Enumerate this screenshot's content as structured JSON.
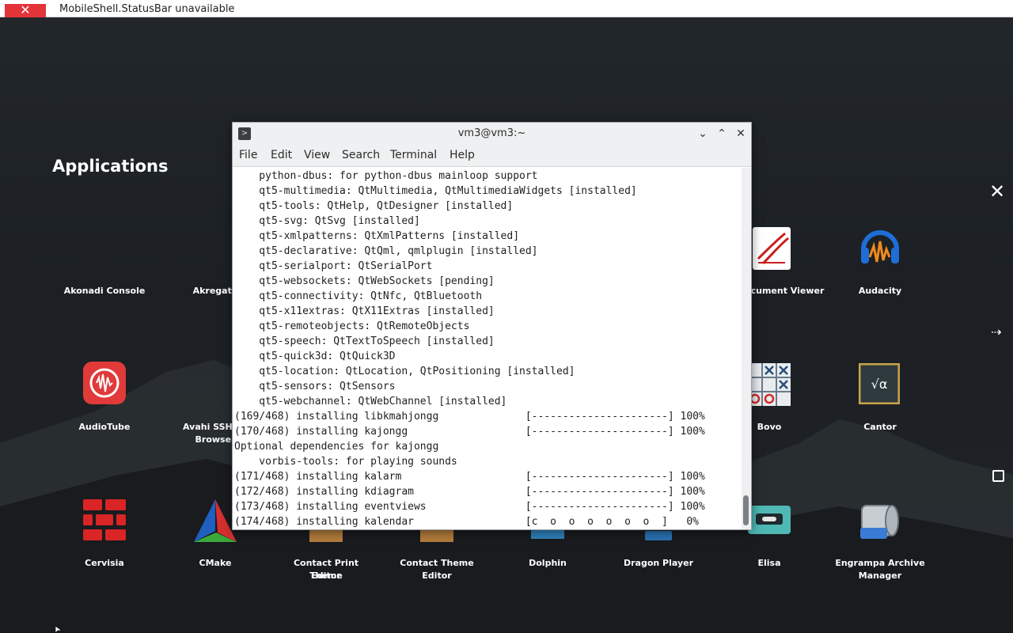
{
  "statusbar": {
    "close_glyph": "✕",
    "text": "MobileShell.StatusBar unavailable"
  },
  "launcher": {
    "title": "Applications",
    "close_glyph": "✕",
    "side_arrow_glyph": "⇢",
    "apps": [
      {
        "label": "Akonadi Console",
        "icon": "akonadi-console-icon"
      },
      {
        "label": "Akregato",
        "icon": "akregator-icon"
      },
      {
        "label": "cument Viewer",
        "icon": "document-viewer-icon"
      },
      {
        "label": "Audacity",
        "icon": "audacity-icon"
      },
      {
        "label": "AudioTube",
        "icon": "audiotube-icon"
      },
      {
        "label": "Avahi SSH Se",
        "label2": "Browser",
        "icon": "avahi-ssh-icon"
      },
      {
        "label": "Bovo",
        "icon": "bovo-icon"
      },
      {
        "label": "Cantor",
        "icon": "cantor-icon"
      },
      {
        "label": "Cervisia",
        "icon": "cervisia-icon"
      },
      {
        "label": "CMake",
        "icon": "cmake-icon"
      },
      {
        "label": "Contact Print Theme",
        "label2": "Editor",
        "icon": "contact-print-theme-icon"
      },
      {
        "label": "Contact Theme Editor",
        "icon": "contact-theme-editor-icon"
      },
      {
        "label": "Dolphin",
        "icon": "dolphin-icon"
      },
      {
        "label": "Dragon Player",
        "icon": "dragon-player-icon"
      },
      {
        "label": "Elisa",
        "icon": "elisa-icon"
      },
      {
        "label": "Engrampa Archive",
        "label2": "Manager",
        "icon": "engrampa-icon"
      }
    ]
  },
  "terminal": {
    "title": "vm3@vm3:~",
    "menu": [
      "File",
      "Edit",
      "View",
      "Search",
      "Terminal",
      "Help"
    ],
    "lines": [
      "    python-dbus: for python-dbus mainloop support",
      "    qt5-multimedia: QtMultimedia, QtMultimediaWidgets [installed]",
      "    qt5-tools: QtHelp, QtDesigner [installed]",
      "    qt5-svg: QtSvg [installed]",
      "    qt5-xmlpatterns: QtXmlPatterns [installed]",
      "    qt5-declarative: QtQml, qmlplugin [installed]",
      "    qt5-serialport: QtSerialPort",
      "    qt5-websockets: QtWebSockets [pending]",
      "    qt5-connectivity: QtNfc, QtBluetooth",
      "    qt5-x11extras: QtX11Extras [installed]",
      "    qt5-remoteobjects: QtRemoteObjects",
      "    qt5-speech: QtTextToSpeech [installed]",
      "    qt5-quick3d: QtQuick3D",
      "    qt5-location: QtLocation, QtPositioning [installed]",
      "    qt5-sensors: QtSensors",
      "    qt5-webchannel: QtWebChannel [installed]",
      "(169/468) installing libkmahjongg              [----------------------] 100%",
      "(170/468) installing kajongg                   [----------------------] 100%",
      "Optional dependencies for kajongg",
      "    vorbis-tools: for playing sounds",
      "(171/468) installing kalarm                    [----------------------] 100%",
      "(172/468) installing kdiagram                  [----------------------] 100%",
      "(173/468) installing eventviews                [----------------------] 100%",
      "(174/468) installing kalendar                  [c  o  o  o  o  o  o  ]   0%"
    ]
  }
}
